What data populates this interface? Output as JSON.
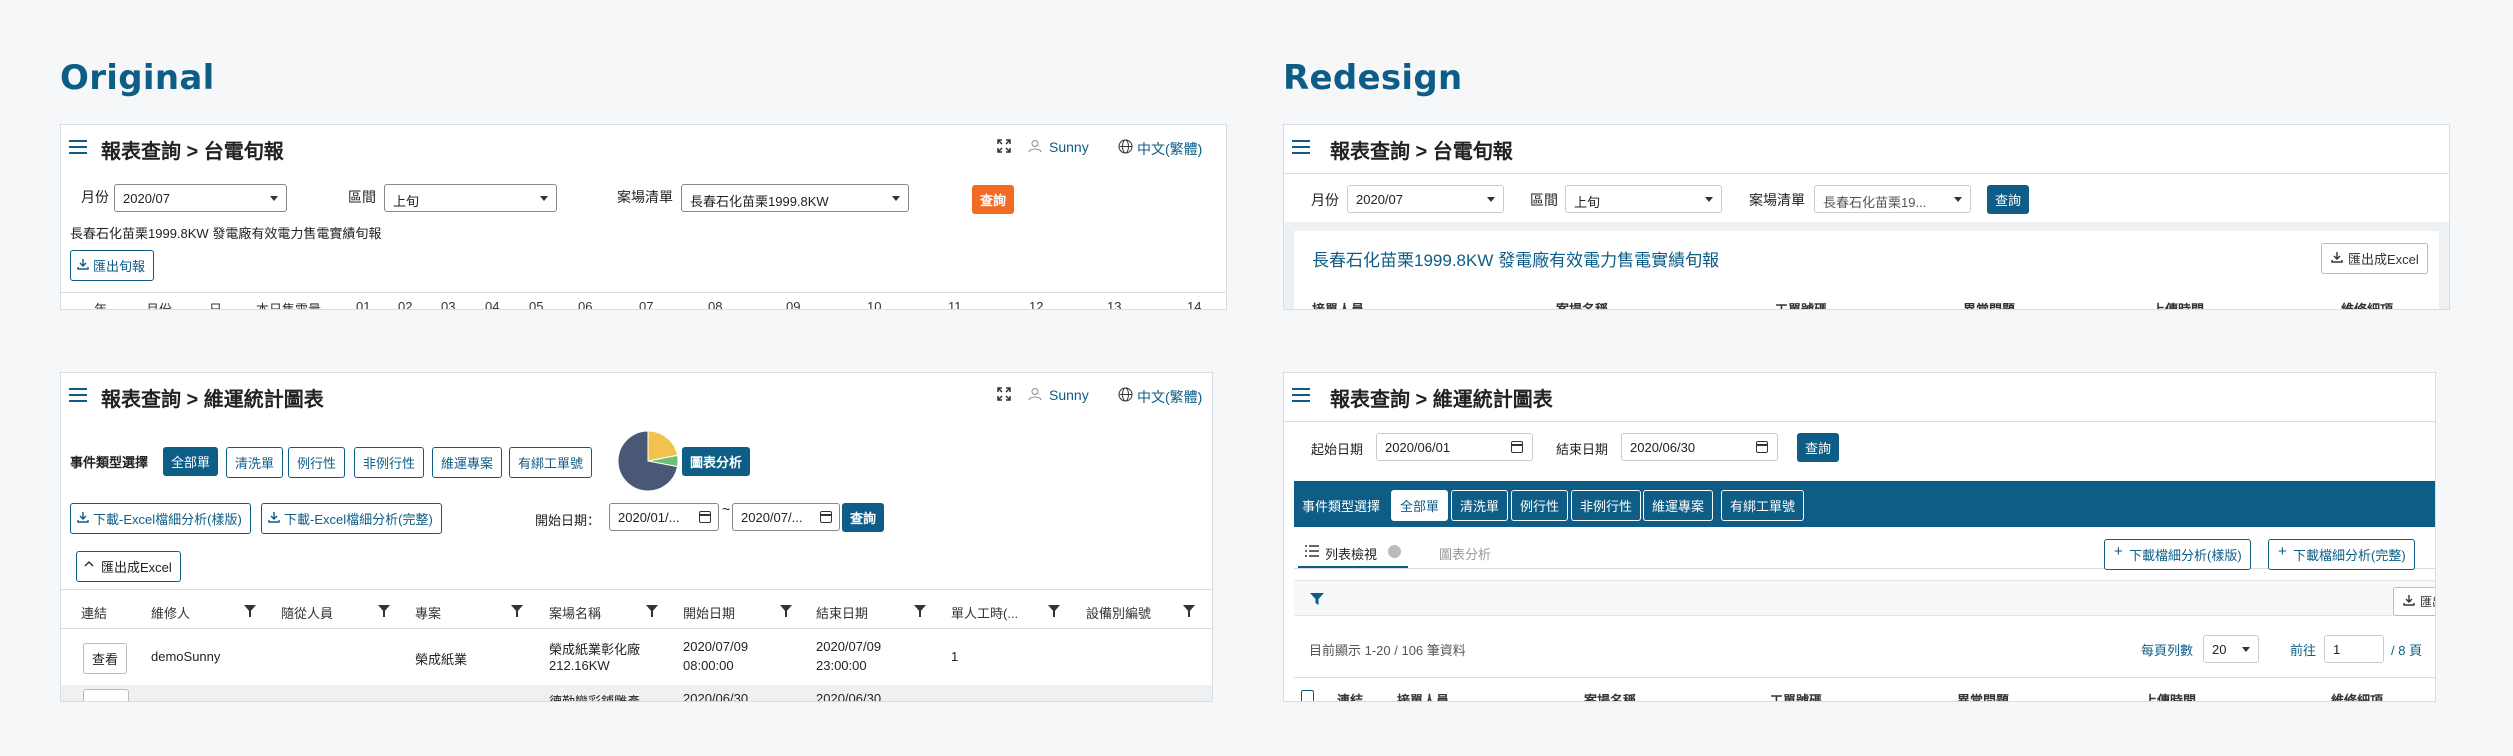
{
  "headings": {
    "original": "Original",
    "redesign": "Redesign"
  },
  "common": {
    "user": "Sunny",
    "lang": "中文(繁體)"
  },
  "p1": {
    "title": "報表查詢 > 台電旬報",
    "month_label": "月份",
    "month_value": "2020/07",
    "period_label": "區間",
    "period_value": "上旬",
    "site_label": "案場清單",
    "site_value": "長春石化苗栗1999.8KW",
    "query_btn": "查詢",
    "report_name": "長春石化苗栗1999.8KW 發電廠有效電力售電實績旬報",
    "export_btn": "匯出旬報",
    "columns": [
      "年",
      "月份",
      "日",
      "本日售電量",
      "01",
      "02",
      "03",
      "04",
      "05",
      "06",
      "07",
      "08",
      "09",
      "10",
      "11",
      "12",
      "13",
      "14"
    ]
  },
  "p2": {
    "title": "報表查詢 > 台電旬報",
    "month_label": "月份",
    "month_value": "2020/07",
    "period_label": "區間",
    "period_value": "上旬",
    "site_label": "案場清單",
    "site_value": "長春石化苗栗19...",
    "query_btn": "查詢",
    "report_title": "長春石化苗栗1999.8KW 發電廠有效電力售電實績旬報",
    "export_btn": "匯出成Excel",
    "columns": [
      "接單人員",
      "案場名稱",
      "工單號碼",
      "異常問題",
      "上傳時間",
      "維修細項"
    ]
  },
  "p3": {
    "title": "報表查詢 > 維運統計圖表",
    "type_label": "事件類型選擇",
    "types": [
      "全部單",
      "清洗單",
      "例行性",
      "非例行性",
      "維運專案",
      "有綁工單號"
    ],
    "chart_btn": "圖表分析",
    "dl_sample": "下載-Excel檔細分析(樣版)",
    "dl_full": "下載-Excel檔細分析(完整)",
    "start_label": "開始日期：",
    "start_value": "2020/01/...",
    "end_value": "2020/07/...",
    "tilde": "~",
    "query_btn": "查詢",
    "export_btn": "匯出成Excel",
    "columns": [
      "連結",
      "維修人",
      "隨從人員",
      "專案",
      "案場名稱",
      "開始日期",
      "結束日期",
      "單人工時(...",
      "設備別編號"
    ],
    "row1": {
      "action": "查看",
      "person": "demoSunny",
      "project": "榮成紙業",
      "site_l1": "榮成紙業彰化廠",
      "site_l2": "212.16KW",
      "start_l1": "2020/07/09",
      "start_l2": "08:00:00",
      "end_l1": "2020/07/09",
      "end_l2": "23:00:00",
      "hours": "1"
    },
    "row2": {
      "site_l1": "德勤彎彩鋪雕產",
      "start_l1": "2020/06/30",
      "end_l1": "2020/06/30"
    },
    "pie": [
      {
        "label": "slice-1",
        "value": 0.22,
        "color": "#f2c14e"
      },
      {
        "label": "slice-2",
        "value": 0.06,
        "color": "#6cc070"
      },
      {
        "label": "slice-3",
        "value": 0.72,
        "color": "#4a5878"
      }
    ]
  },
  "p4": {
    "title": "報表查詢 > 維運統計圖表",
    "start_label": "起始日期",
    "start_value": "2020/06/01",
    "end_label": "結束日期",
    "end_value": "2020/06/30",
    "query_btn": "查詢",
    "type_label": "事件類型選擇",
    "types": [
      "全部單",
      "清洗單",
      "例行性",
      "非例行性",
      "維運專案",
      "有綁工單號"
    ],
    "tab_list": "列表檢視",
    "tab_chart": "圖表分析",
    "dl_sample": "下載檔細分析(樣版)",
    "dl_full": "下載檔細分析(完整)",
    "export_btn": "匯出成Excel",
    "records": "目前顯示 1-20 / 106 筆資料",
    "page_size_label": "每頁列數",
    "page_size": "20",
    "goto_label": "前往",
    "page_value": "1",
    "page_total": "/ 8 頁",
    "columns": [
      "連結",
      "接單人員",
      "案場名稱",
      "工單號碼",
      "異常問題",
      "上傳時間",
      "維修細項"
    ]
  }
}
